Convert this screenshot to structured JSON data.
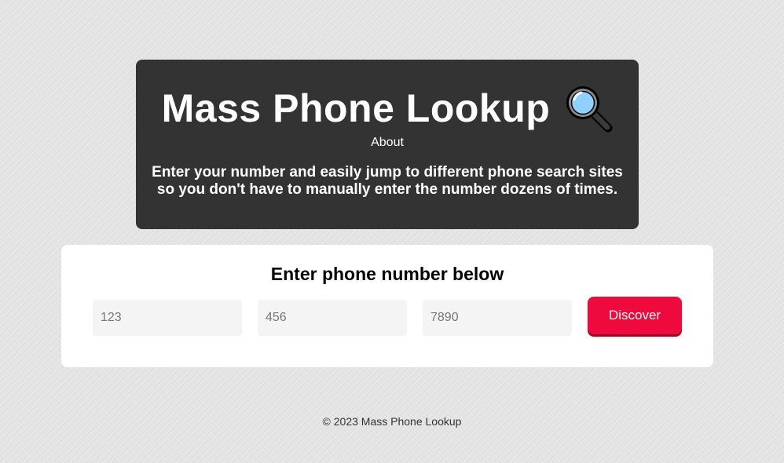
{
  "header": {
    "title": "Mass Phone Lookup",
    "title_icon": "magnifying-glass-icon",
    "about_label": "About",
    "tagline_lines": [
      "Enter your number and easily jump to different phone search sites",
      "so you don't have to manually enter the number dozens of times."
    ]
  },
  "lookup": {
    "heading": "Enter phone number below",
    "inputs": [
      {
        "placeholder": "123",
        "value": ""
      },
      {
        "placeholder": "456",
        "value": ""
      },
      {
        "placeholder": "7890",
        "value": ""
      }
    ],
    "button_label": "Discover",
    "button_color": "#ee0a3c"
  },
  "footer": {
    "text": "© 2023 Mass Phone Lookup"
  },
  "colors": {
    "header_bg": "#333333",
    "page_bg": "#e6e6e6",
    "card_bg": "#ffffff"
  }
}
